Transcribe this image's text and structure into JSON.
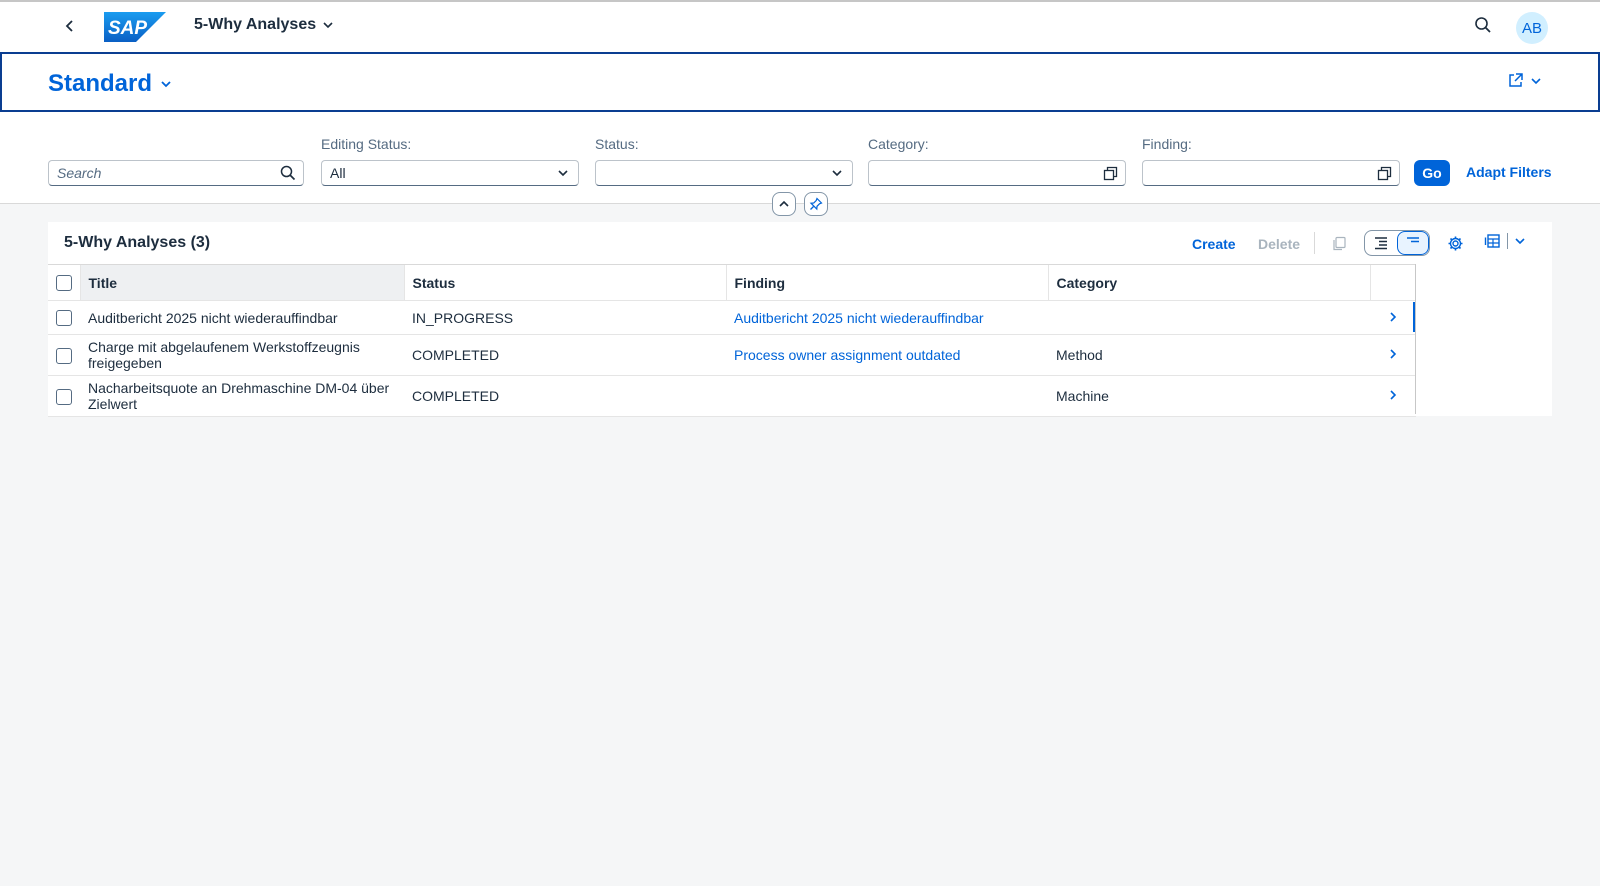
{
  "shell": {
    "logo_text": "SAP",
    "app_title": "5-Why Analyses",
    "avatar_initials": "AB",
    "brand_color": "#0064d9"
  },
  "variant": {
    "title": "Standard"
  },
  "filters": {
    "search_placeholder": "Search",
    "editing_status_label": "Editing Status:",
    "editing_status_value": "All",
    "status_label": "Status:",
    "status_value": "",
    "category_label": "Category:",
    "category_value": "",
    "finding_label": "Finding:",
    "finding_value": "",
    "go_label": "Go",
    "adapt_label": "Adapt Filters"
  },
  "table": {
    "title": "5-Why Analyses (3)",
    "create_label": "Create",
    "delete_label": "Delete",
    "columns": [
      "Title",
      "Status",
      "Finding",
      "Category"
    ],
    "rows": [
      {
        "title": "Auditbericht 2025 nicht wiederauffindbar",
        "status": "IN_PROGRESS",
        "finding": "Auditbericht 2025 nicht wiederauffindbar",
        "category": ""
      },
      {
        "title": "Charge mit abgelaufenem Werkstoffzeugnis freigegeben",
        "status": "COMPLETED",
        "finding": "Process owner assignment outdated",
        "category": "Method"
      },
      {
        "title": "Nacharbeitsquote an Drehmaschine DM-04 über Zielwert",
        "status": "COMPLETED",
        "finding": "",
        "category": "Machine"
      }
    ]
  }
}
